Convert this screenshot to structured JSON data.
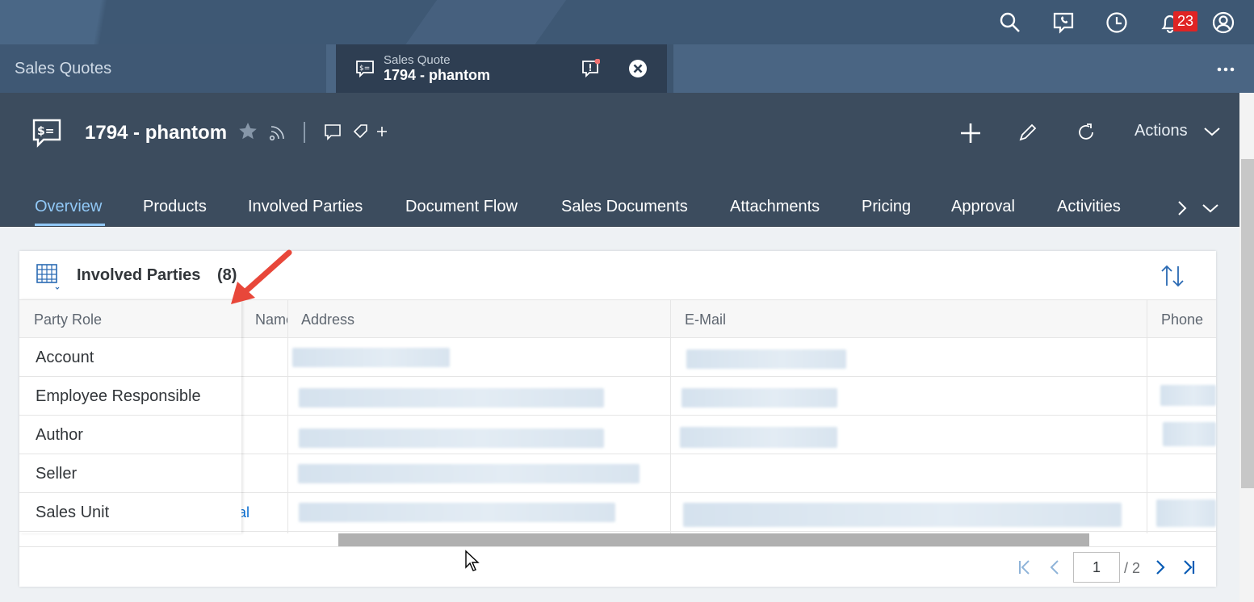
{
  "shell": {
    "icons": [
      "search-icon",
      "phone-chat-icon",
      "clock-icon",
      "bell-icon",
      "user-icon"
    ],
    "notification_count": "23"
  },
  "tabs": {
    "home_label": "Sales Quotes",
    "active_subtitle": "Sales Quote",
    "active_title": "1794 - phantom",
    "overflow_icon": "more-icon"
  },
  "header": {
    "title": "1794 - phantom",
    "actions_label": "Actions"
  },
  "nav": {
    "tabs": [
      "Overview",
      "Products",
      "Involved Parties",
      "Document Flow",
      "Sales Documents",
      "Attachments",
      "Pricing",
      "Approval",
      "Activities"
    ],
    "active_index": 0
  },
  "card": {
    "title": "Involved Parties",
    "count": "(8)",
    "columns": [
      "Party Role",
      "Name",
      "Address",
      "E-Mail",
      "Phone"
    ],
    "rows": [
      "Account",
      "Employee Responsible",
      "Author",
      "Seller",
      "Sales Unit"
    ],
    "name_fragment": "al"
  },
  "pager": {
    "current": "1",
    "total": "/ 2"
  },
  "colors": {
    "shell": "#3f5772",
    "header": "#3c4c5e",
    "active_tab": "#91c8f6",
    "badge": "#e02424",
    "arrow": "#e8473a"
  }
}
